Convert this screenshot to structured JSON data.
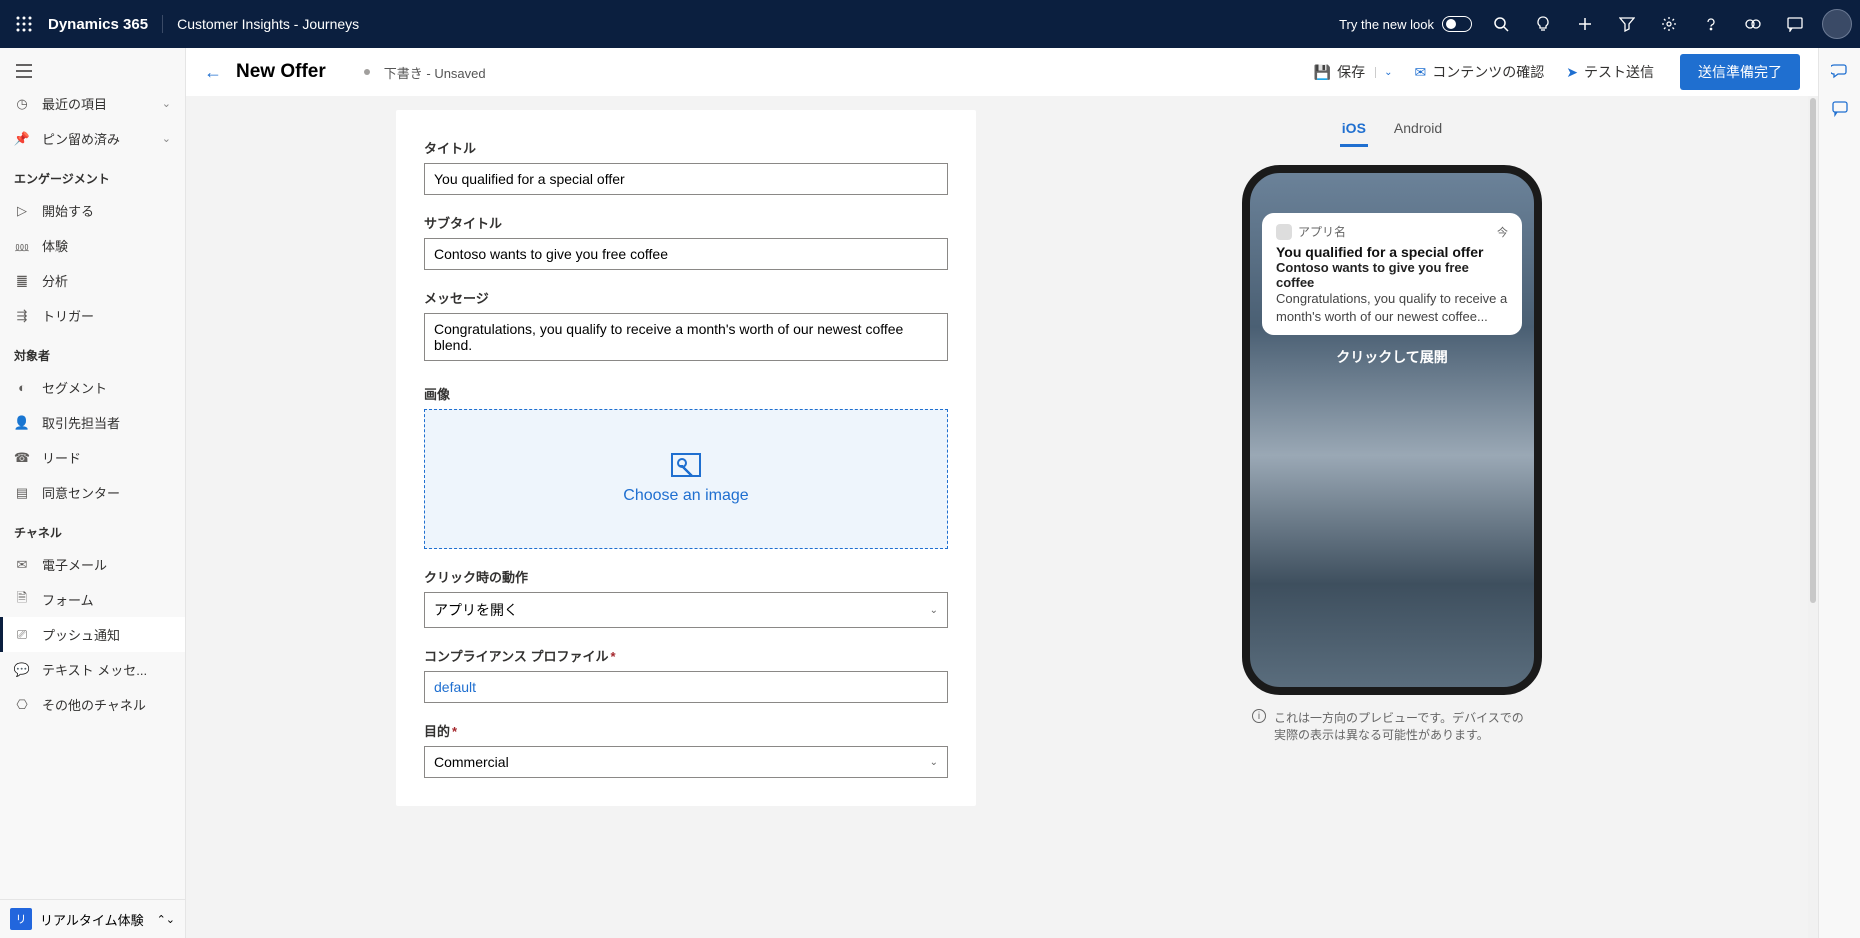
{
  "topbar": {
    "brand": "Dynamics 365",
    "subbrand": "Customer Insights - Journeys",
    "newlook": "Try the new look"
  },
  "sidebar": {
    "recent": "最近の項目",
    "pinned": "ピン留め済み",
    "sections": {
      "engagement": "エンゲージメント",
      "audience": "対象者",
      "channels": "チャネル"
    },
    "items": {
      "start": "開始する",
      "experience": "体験",
      "analytics": "分析",
      "triggers": "トリガー",
      "segments": "セグメント",
      "contacts": "取引先担当者",
      "leads": "リード",
      "consent": "同意センター",
      "emails": "電子メール",
      "forms": "フォーム",
      "push": "プッシュ通知",
      "text": "テキスト メッセ...",
      "other": "その他のチャネル"
    },
    "footer": {
      "glyph": "リ",
      "label": "リアルタイム体験"
    }
  },
  "page": {
    "title": "New Offer",
    "draft": "下書き",
    "unsaved": " - Unsaved",
    "actions": {
      "save": "保存",
      "check": "コンテンツの確認",
      "test": "テスト送信",
      "ready": "送信準備完了"
    }
  },
  "form": {
    "labels": {
      "title": "タイトル",
      "subtitle": "サブタイトル",
      "message": "メッセージ",
      "image": "画像",
      "choose_image": "Choose an image",
      "onclick": "クリック時の動作",
      "compliance": "コンプライアンス プロファイル",
      "purpose": "目的"
    },
    "values": {
      "title": "You qualified for a special offer",
      "subtitle": "Contoso wants to give you free coffee",
      "message": "Congratulations, you qualify to receive a month's worth of our newest coffee blend.",
      "onclick": "アプリを開く",
      "compliance": "default",
      "purpose": "Commercial"
    }
  },
  "preview": {
    "tabs": {
      "ios": "iOS",
      "android": "Android"
    },
    "appname": "アプリ名",
    "now": "今",
    "title": "You qualified for a special offer",
    "subtitle": "Contoso wants to give you free coffee",
    "message": "Congratulations, you qualify to receive a month's worth of our newest coffee...",
    "expand": "クリックして展開",
    "disclaimer": "これは一方向のプレビューです。デバイスでの実際の表示は異なる可能性があります。"
  }
}
